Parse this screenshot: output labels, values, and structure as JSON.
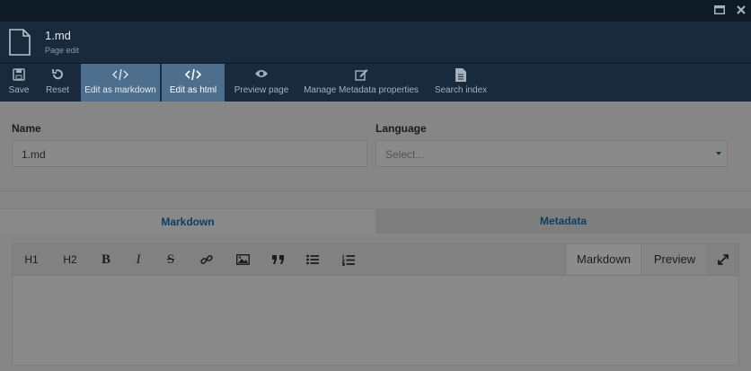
{
  "file": {
    "name": "1.md",
    "subtitle": "Page edit"
  },
  "toolbar": {
    "items": [
      {
        "label": "Save",
        "icon": "save-icon"
      },
      {
        "label": "Reset",
        "icon": "reset-icon"
      },
      {
        "label": "Edit as markdown",
        "icon": "code-icon"
      },
      {
        "label": "Edit as html",
        "icon": "code-icon"
      },
      {
        "label": "Preview page",
        "icon": "eye-icon"
      },
      {
        "label": "Manage Metadata properties",
        "icon": "edit-icon"
      },
      {
        "label": "Search index",
        "icon": "document-icon"
      }
    ]
  },
  "form": {
    "name_label": "Name",
    "name_value": "1.md",
    "language_label": "Language",
    "language_placeholder": "Select..."
  },
  "tabs": {
    "markdown": "Markdown",
    "metadata": "Metadata"
  },
  "editor": {
    "h1": "H1",
    "h2": "H2",
    "bold": "B",
    "italic": "I",
    "strike": "S",
    "mode_markdown": "Markdown",
    "mode_preview": "Preview"
  },
  "colors": {
    "accent": "#1a73b0",
    "toolbar": "#182a3b",
    "active": "#4d6e8c"
  }
}
